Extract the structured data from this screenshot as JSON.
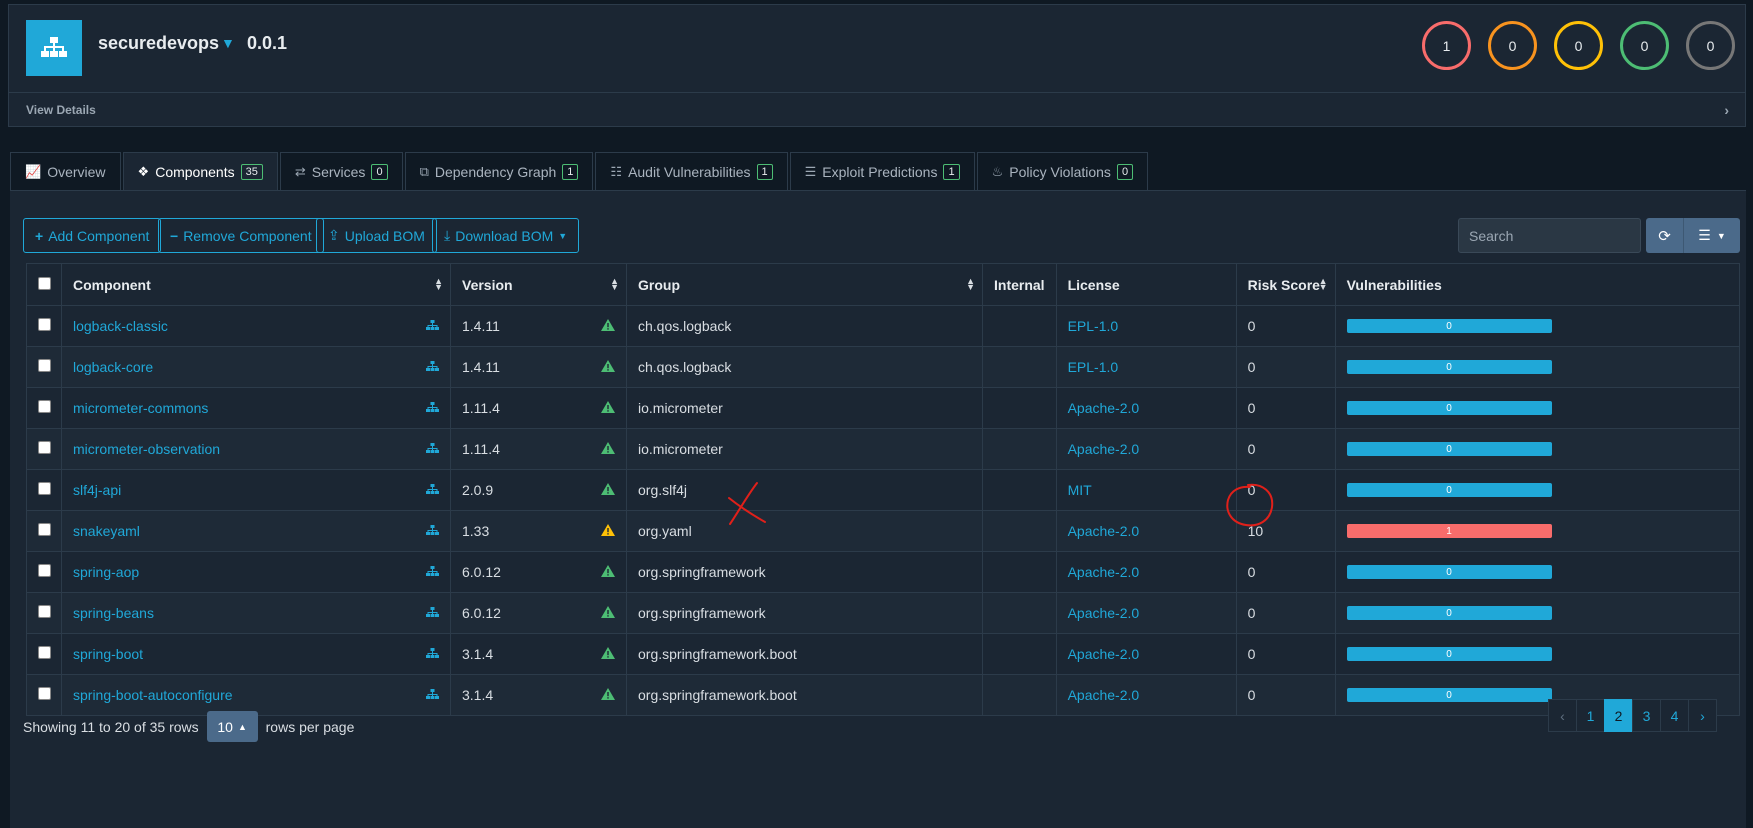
{
  "project": {
    "name": "securedevops",
    "version": "0.0.1",
    "view_details": "View Details",
    "severity_counts": [
      {
        "name": "critical",
        "count": "1",
        "color": "#f86c6b"
      },
      {
        "name": "high",
        "count": "0",
        "color": "#f8931f"
      },
      {
        "name": "medium",
        "count": "0",
        "color": "#ffc107"
      },
      {
        "name": "low",
        "count": "0",
        "color": "#4dbd74"
      },
      {
        "name": "unassigned",
        "count": "0",
        "color": "#777777"
      }
    ]
  },
  "tabs": [
    {
      "label": "Overview",
      "icon": "chart-icon"
    },
    {
      "label": "Components",
      "badge": "35",
      "icon": "cubes-icon"
    },
    {
      "label": "Services",
      "badge": "0",
      "icon": "exchange-icon"
    },
    {
      "label": "Dependency Graph",
      "badge": "1",
      "icon": "sitemap-icon"
    },
    {
      "label": "Audit Vulnerabilities",
      "badge": "1",
      "icon": "tasks-icon"
    },
    {
      "label": "Exploit Predictions",
      "badge": "1",
      "icon": "list-icon"
    },
    {
      "label": "Policy Violations",
      "badge": "0",
      "icon": "fire-icon"
    }
  ],
  "toolbar": {
    "add_component": "Add Component",
    "remove_component": "Remove Component",
    "upload_bom": "Upload BOM",
    "download_bom": "Download BOM",
    "search_placeholder": "Search"
  },
  "table": {
    "columns": [
      "Component",
      "Version",
      "Group",
      "Internal",
      "License",
      "Risk Score",
      "Vulnerabilities"
    ],
    "rows": [
      {
        "component": "logback-classic",
        "version": "1.4.11",
        "group": "ch.qos.logback",
        "internal": "",
        "license": "EPL-1.0",
        "risk": "0",
        "vulns": "0",
        "status": "ok"
      },
      {
        "component": "logback-core",
        "version": "1.4.11",
        "group": "ch.qos.logback",
        "internal": "",
        "license": "EPL-1.0",
        "risk": "0",
        "vulns": "0",
        "status": "ok"
      },
      {
        "component": "micrometer-commons",
        "version": "1.11.4",
        "group": "io.micrometer",
        "internal": "",
        "license": "Apache-2.0",
        "risk": "0",
        "vulns": "0",
        "status": "ok"
      },
      {
        "component": "micrometer-observation",
        "version": "1.11.4",
        "group": "io.micrometer",
        "internal": "",
        "license": "Apache-2.0",
        "risk": "0",
        "vulns": "0",
        "status": "ok"
      },
      {
        "component": "slf4j-api",
        "version": "2.0.9",
        "group": "org.slf4j",
        "internal": "",
        "license": "MIT",
        "risk": "0",
        "vulns": "0",
        "status": "ok"
      },
      {
        "component": "snakeyaml",
        "version": "1.33",
        "group": "org.yaml",
        "internal": "",
        "license": "Apache-2.0",
        "risk": "10",
        "vulns": "1",
        "status": "warn"
      },
      {
        "component": "spring-aop",
        "version": "6.0.12",
        "group": "org.springframework",
        "internal": "",
        "license": "Apache-2.0",
        "risk": "0",
        "vulns": "0",
        "status": "ok"
      },
      {
        "component": "spring-beans",
        "version": "6.0.12",
        "group": "org.springframework",
        "internal": "",
        "license": "Apache-2.0",
        "risk": "0",
        "vulns": "0",
        "status": "ok"
      },
      {
        "component": "spring-boot",
        "version": "3.1.4",
        "group": "org.springframework.boot",
        "internal": "",
        "license": "Apache-2.0",
        "risk": "0",
        "vulns": "0",
        "status": "ok"
      },
      {
        "component": "spring-boot-autoconfigure",
        "version": "3.1.4",
        "group": "org.springframework.boot",
        "internal": "",
        "license": "Apache-2.0",
        "risk": "0",
        "vulns": "0",
        "status": "ok"
      }
    ]
  },
  "footer": {
    "showing": "Showing 11 to 20 of 35 rows",
    "page_size": "10",
    "rows_per_page": "rows per page",
    "pages": [
      "‹",
      "1",
      "2",
      "3",
      "4",
      "›"
    ],
    "current_page": "2"
  },
  "colors": {
    "accent": "#20a8d8",
    "danger": "#f86c6b",
    "success": "#4dbd74",
    "warning": "#ffc107",
    "annotation": "#e0201a"
  }
}
